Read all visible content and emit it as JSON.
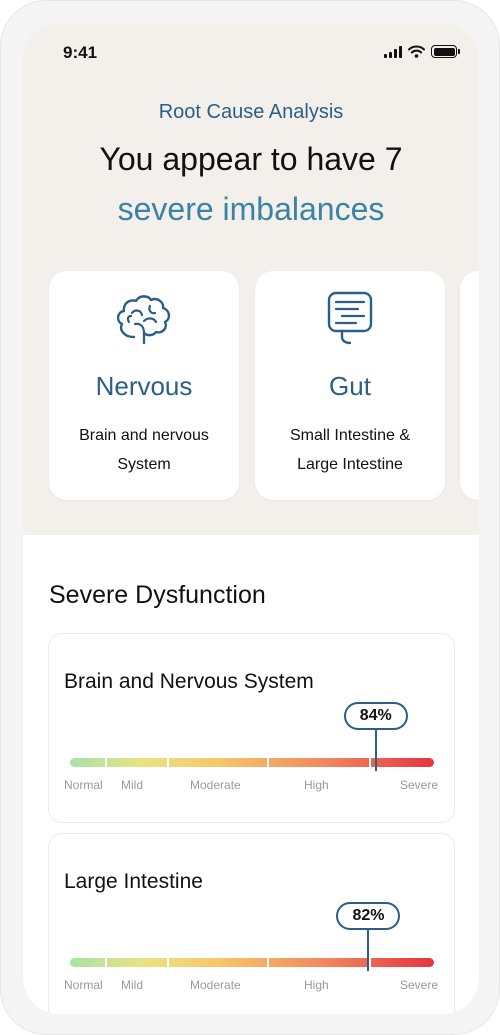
{
  "status_bar": {
    "time": "9:41"
  },
  "hero": {
    "eyebrow": "Root Cause Analysis",
    "headline": "You appear to have 7",
    "headline_accent": "severe imbalances"
  },
  "systems": [
    {
      "icon": "brain-icon",
      "title": "Nervous",
      "description": "Brain and nervous System"
    },
    {
      "icon": "gut-icon",
      "title": "Gut",
      "description": "Small Intestine & Large Intestine"
    }
  ],
  "section_title": "Severe Dysfunction",
  "scale_labels": [
    "Normal",
    "Mild",
    "Moderate",
    "High",
    "Severe"
  ],
  "metrics": [
    {
      "title": "Brain and Nervous System",
      "percent_label": "84%",
      "percent": 84
    },
    {
      "title": "Large Intestine",
      "percent_label": "82%",
      "percent": 82
    }
  ],
  "colors": {
    "primary": "#2b5f87",
    "accent": "#3a83a3",
    "hero_background": "#f3f0eb",
    "scale_normal": "#a7e3a7",
    "scale_severe": "#e4343f"
  }
}
